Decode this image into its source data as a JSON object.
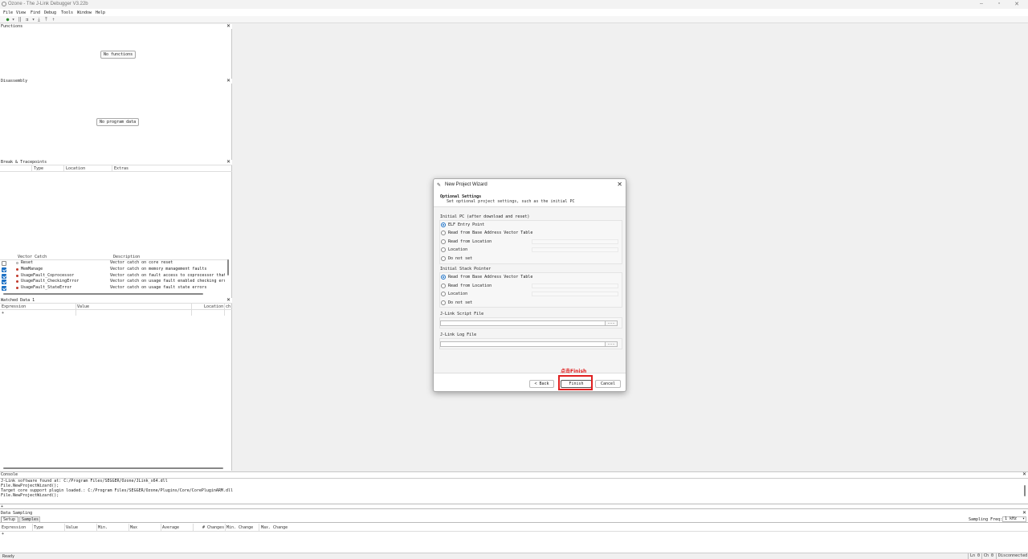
{
  "window": {
    "title": "Ozone - The J-Link Debugger V3.22b"
  },
  "menu": [
    "File",
    "View",
    "Find",
    "Debug",
    "Tools",
    "Window",
    "Help"
  ],
  "panes": {
    "functions": {
      "title": "Functions",
      "empty": "No functions"
    },
    "disassembly": {
      "title": "Disassembly",
      "empty": "No program data"
    },
    "breakpoints": {
      "title": "Break & Tracepoints",
      "columns": [
        "Type",
        "Location",
        "Extras"
      ],
      "vector_columns": [
        "Vector Catch",
        "Description"
      ],
      "vectors": [
        {
          "checked": false,
          "hollow": true,
          "name": "Reset",
          "desc": "Vector catch on core reset"
        },
        {
          "checked": true,
          "hollow": false,
          "name": "MemManage",
          "desc": "Vector catch on memory management faults"
        },
        {
          "checked": true,
          "hollow": false,
          "name": "UsageFault_Coprocessor",
          "desc": "Vector catch on fault access to coprocessor that"
        },
        {
          "checked": true,
          "hollow": false,
          "name": "UsageFault_CheckingError",
          "desc": "Vector catch on usage fault enabled checking error"
        },
        {
          "checked": true,
          "hollow": false,
          "name": "UsageFault_StateError",
          "desc": "Vector catch on usage fault state errors"
        }
      ]
    },
    "watched": {
      "title": "Watched Data 1",
      "columns": [
        "Expression",
        "Value",
        "Location",
        "ch"
      ],
      "new_row": "+"
    }
  },
  "console": {
    "title": "Console",
    "lines": [
      "J-Link software found at: C:/Program Files/SEGGER/Ozone/JLink_x64.dll",
      "File.NewProjectWizard();",
      "Target core support plugin loaded.: C:/Program Files/SEGGER/Ozone/Plugins/Core/CorePluginARM.dll",
      "File.NewProjectWizard();"
    ],
    "prompt": "+"
  },
  "sampling": {
    "title": "Data Sampling",
    "tabs": [
      "Setup",
      "Samples"
    ],
    "freq_label": "Sampling Freq:",
    "freq_value": "1 kHz",
    "columns": [
      "Expression",
      "Type",
      "Value",
      "Min.",
      "Max",
      "Average",
      "# Changes",
      "Min. Change",
      "Max. Change"
    ],
    "new_row": "+"
  },
  "status": {
    "left": "Ready",
    "ln": "Ln 0",
    "ch": "Ch 0",
    "conn": "Disconnected"
  },
  "dialog": {
    "title": "New Project Wizard",
    "heading": "Optional Settings",
    "subheading": "Set optional project settings, such as the initial PC",
    "pc_group": {
      "title": "Initial PC (after download and reset)",
      "options": [
        "ELF Entry Point",
        "Read from Base Address Vector Table",
        "Read from Location",
        "Location",
        "Do not set"
      ],
      "selected": 0
    },
    "sp_group": {
      "title": "Initial Stack Pointer",
      "options": [
        "Read from Base Address Vector Table",
        "Read from Location",
        "Location",
        "Do not set"
      ],
      "selected": 0
    },
    "script_label": "J-Link Script File",
    "log_label": "J-Link Log File",
    "browse": "...",
    "back": "< Back",
    "finish": "Finish",
    "cancel": "Cancel"
  },
  "annotation": "点击Finish",
  "colors": {
    "accent": "#1a6fc4",
    "highlight": "#e02020"
  }
}
